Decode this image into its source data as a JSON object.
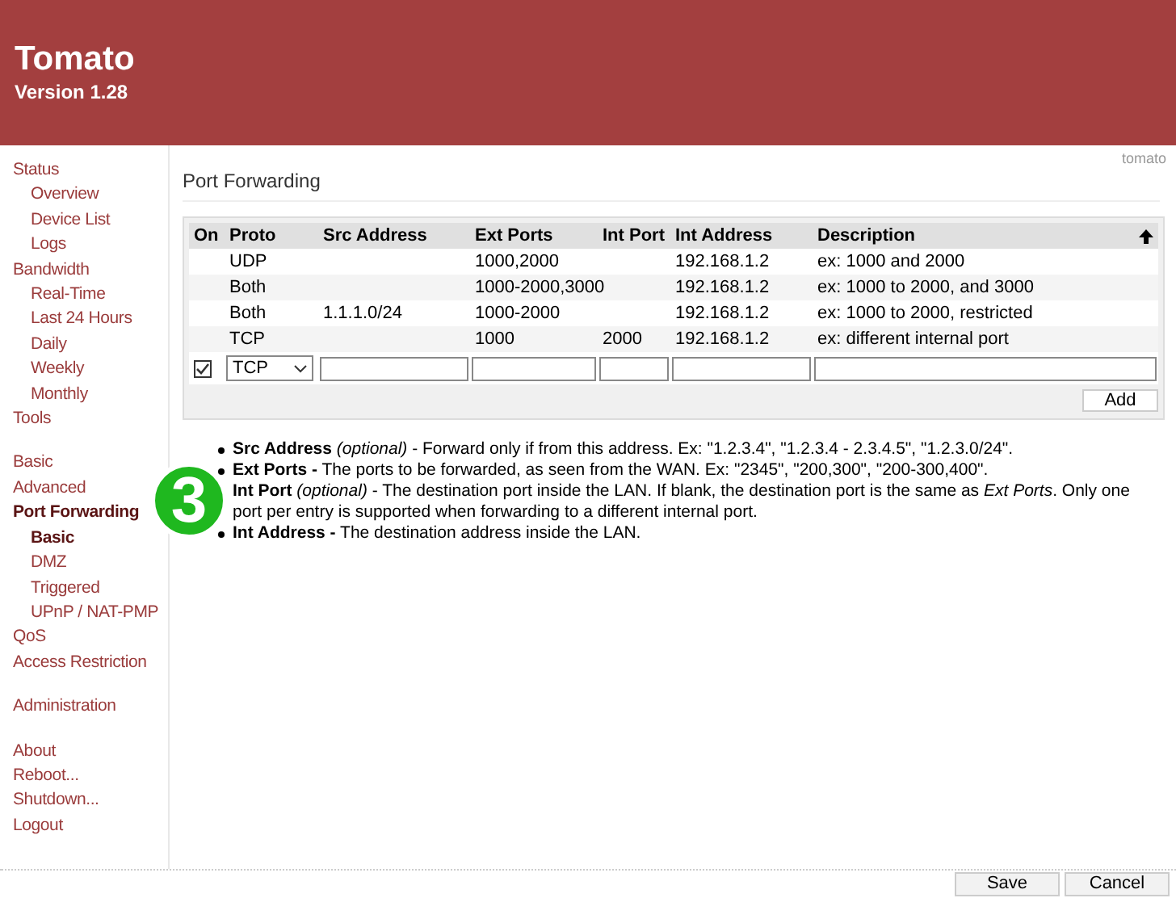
{
  "header": {
    "title": "Tomato",
    "version": "Version 1.28"
  },
  "sidebar": {
    "groups": [
      {
        "items": [
          {
            "label": "Status",
            "selected": false,
            "children": [
              {
                "label": "Overview",
                "selected": false
              },
              {
                "label": "Device List",
                "selected": false
              },
              {
                "label": "Logs",
                "selected": false
              }
            ]
          },
          {
            "label": "Bandwidth",
            "selected": false,
            "children": [
              {
                "label": "Real-Time",
                "selected": false
              },
              {
                "label": "Last 24 Hours",
                "selected": false
              },
              {
                "label": "Daily",
                "selected": false
              },
              {
                "label": "Weekly",
                "selected": false
              },
              {
                "label": "Monthly",
                "selected": false
              }
            ]
          },
          {
            "label": "Tools",
            "selected": false
          }
        ]
      },
      {
        "items": [
          {
            "label": "Basic",
            "selected": false
          },
          {
            "label": "Advanced",
            "selected": false
          },
          {
            "label": "Port Forwarding",
            "selected": true,
            "children": [
              {
                "label": "Basic",
                "selected": true
              },
              {
                "label": "DMZ",
                "selected": false
              },
              {
                "label": "Triggered",
                "selected": false
              },
              {
                "label": "UPnP / NAT-PMP",
                "selected": false
              }
            ]
          },
          {
            "label": "QoS",
            "selected": false
          },
          {
            "label": "Access Restriction",
            "selected": false
          }
        ]
      },
      {
        "items": [
          {
            "label": "Administration",
            "selected": false
          }
        ]
      },
      {
        "items": [
          {
            "label": "About",
            "selected": false
          },
          {
            "label": "Reboot...",
            "selected": false
          },
          {
            "label": "Shutdown...",
            "selected": false
          },
          {
            "label": "Logout",
            "selected": false
          }
        ]
      }
    ]
  },
  "brand": "tomato",
  "section_title": "Port Forwarding",
  "table": {
    "columns": [
      "On",
      "Proto",
      "Src Address",
      "Ext Ports",
      "Int Port",
      "Int Address",
      "Description"
    ],
    "rows": [
      [
        "",
        "UDP",
        "",
        "1000,2000",
        "",
        "192.168.1.2",
        "ex: 1000 and 2000"
      ],
      [
        "",
        "Both",
        "",
        "1000-2000,3000",
        "",
        "192.168.1.2",
        "ex: 1000 to 2000, and 3000"
      ],
      [
        "",
        "Both",
        "1.1.1.0/24",
        "1000-2000",
        "",
        "192.168.1.2",
        "ex: 1000 to 2000, restricted"
      ],
      [
        "",
        "TCP",
        "",
        "1000",
        "2000",
        "192.168.1.2",
        "ex: different internal port"
      ]
    ],
    "new_row": {
      "checked": true,
      "proto": "TCP"
    },
    "add_button": "Add"
  },
  "notes": [
    "**Src Address** *(optional)* - Forward only if from this address. Ex: \"1.2.3.4\", \"1.2.3.4 - 2.3.4.5\", \"1.2.3.0/24\".",
    "**Ext Ports -** The ports to be forwarded, as seen from the WAN. Ex: \"2345\", \"200,300\", \"200-300,400\".",
    "**Int Port** *(optional)* - The destination port inside the LAN. If blank, the destination port is the same as *Ext Ports*. Only one port per entry is supported when forwarding to a different internal port.",
    "**Int Address -** The destination address inside the LAN."
  ],
  "badge": "3",
  "buttons": [
    "Save",
    "Cancel"
  ]
}
